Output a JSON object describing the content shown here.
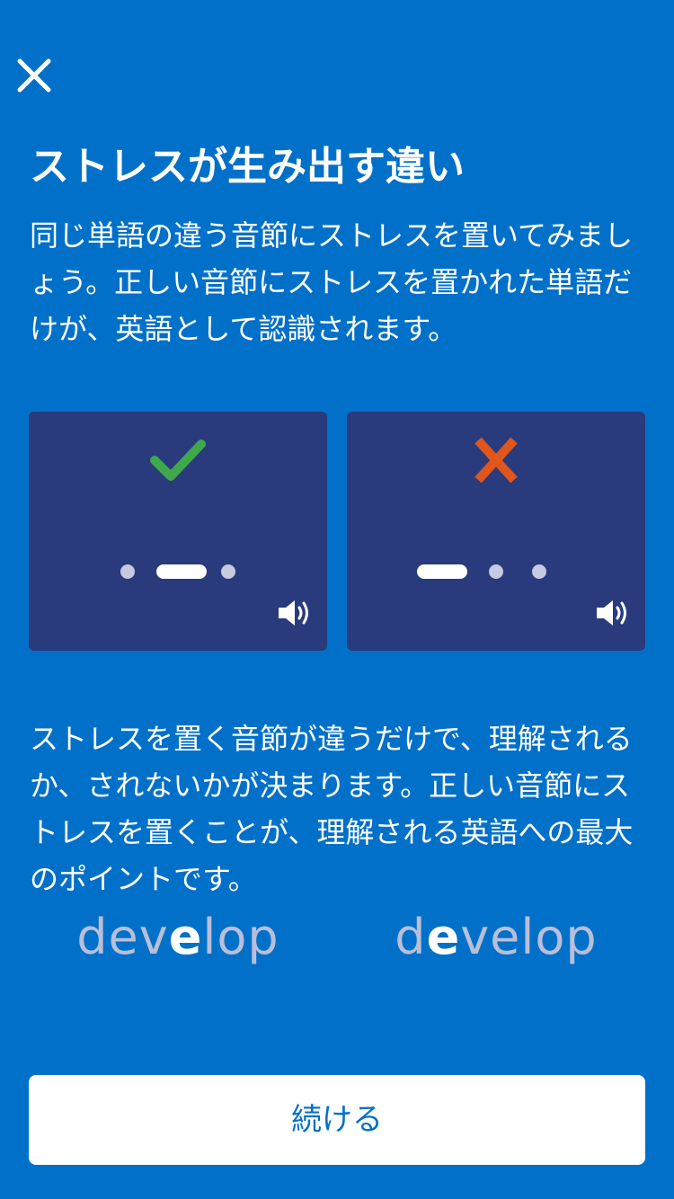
{
  "header": {
    "close_icon": "close-icon"
  },
  "title": "ストレスが生み出す違い",
  "intro": "同じ単語の違う音節にストレスを置いてみましょう。正しい音節にストレスを置かれた単語だけが、英語として認識されます。",
  "cards": [
    {
      "result": "correct",
      "result_icon": "check-icon",
      "result_color": "#3ea84b",
      "word_parts": [
        "dev",
        "e",
        "lop"
      ],
      "stress_pattern": [
        "short",
        "long",
        "short"
      ],
      "audio_icon": "speaker-icon"
    },
    {
      "result": "incorrect",
      "result_icon": "cross-icon",
      "result_color": "#e0561c",
      "word_parts": [
        "d",
        "e",
        "velop"
      ],
      "stress_pattern": [
        "long",
        "short",
        "short"
      ],
      "audio_icon": "speaker-icon"
    }
  ],
  "body": "ストレスを置く音節が違うだけで、理解されるか、されないかが決まります。正しい音節にストレスを置くことが、理解される英語への最大のポイントです。",
  "footer": {
    "continue_label": "続ける"
  },
  "colors": {
    "background": "#0170c9",
    "card": "#293b7c",
    "button": "#ffffff",
    "button_text": "#0170c9"
  }
}
